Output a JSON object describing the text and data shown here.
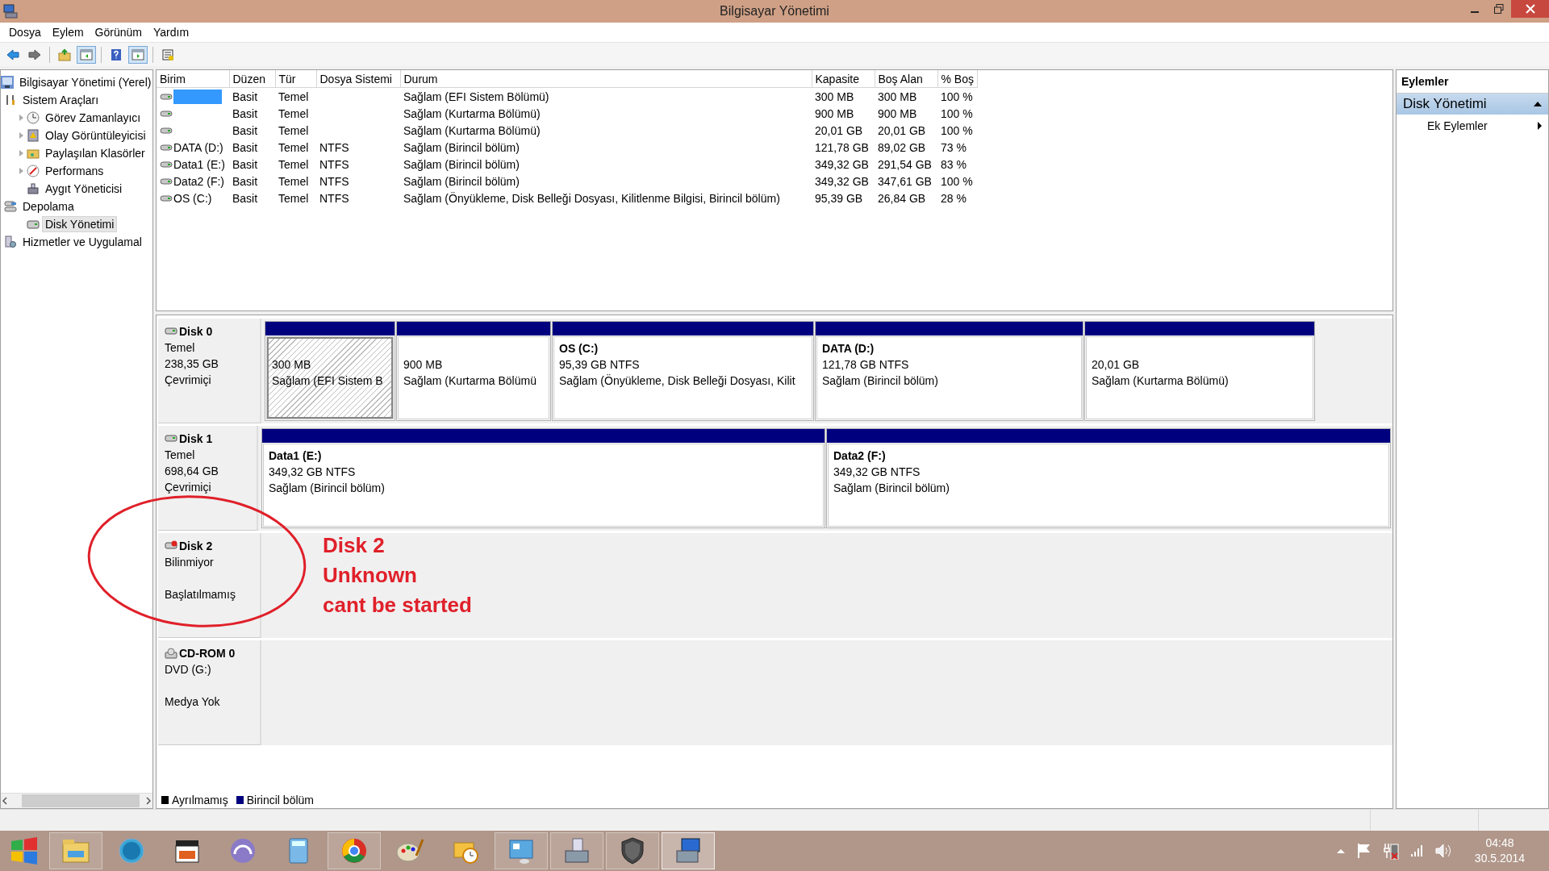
{
  "window": {
    "title": "Bilgisayar Yönetimi"
  },
  "menu": [
    "Dosya",
    "Eylem",
    "Görünüm",
    "Yardım"
  ],
  "toolbar": [
    {
      "pressed": false
    },
    {
      "pressed": false
    },
    {
      "pressed": false
    },
    {
      "pressed": true
    },
    {
      "pressed": false
    },
    {
      "pressed": true
    },
    {
      "pressed": false
    }
  ],
  "tree": [
    {
      "label": "Bilgisayar Yönetimi (Yerel)",
      "expandable": false,
      "selected": false,
      "children": [
        {
          "label": "Sistem Araçları",
          "expandable": false,
          "selected": false,
          "children": [
            {
              "label": "Görev Zamanlayıcı",
              "expandable": true,
              "selected": false
            },
            {
              "label": "Olay Görüntüleyicisi",
              "expandable": true,
              "selected": false
            },
            {
              "label": "Paylaşılan Klasörler",
              "expandable": true,
              "selected": false
            },
            {
              "label": "Performans",
              "expandable": true,
              "selected": false
            },
            {
              "label": "Aygıt Yöneticisi",
              "expandable": false,
              "selected": false
            }
          ]
        },
        {
          "label": "Depolama",
          "expandable": false,
          "selected": false,
          "children": [
            {
              "label": "Disk Yönetimi",
              "expandable": false,
              "selected": true
            }
          ]
        },
        {
          "label": "Hizmetler ve Uygulamal",
          "expandable": false,
          "selected": false
        }
      ]
    }
  ],
  "table": {
    "columns": [
      "Birim",
      "Düzen",
      "Tür",
      "Dosya Sistemi",
      "Durum",
      "Kapasite",
      "Boş Alan",
      "% Boş"
    ],
    "rows": [
      {
        "selected": true,
        "layout": "Basit",
        "type": "Temel",
        "status": "Sağlam (EFI Sistem Bölümü)",
        "capacity": "300 MB",
        "free": "300 MB",
        "free_pct": "100 %"
      },
      {
        "selected": false,
        "layout": "Basit",
        "type": "Temel",
        "status": "Sağlam (Kurtarma Bölümü)",
        "capacity": "900 MB",
        "free": "900 MB",
        "free_pct": "100 %"
      },
      {
        "selected": false,
        "layout": "Basit",
        "type": "Temel",
        "status": "Sağlam (Kurtarma Bölümü)",
        "capacity": "20,01 GB",
        "free": "20,01 GB",
        "free_pct": "100 %"
      },
      {
        "selected": false,
        "volume": "DATA (D:)",
        "layout": "Basit",
        "type": "Temel",
        "fs": "NTFS",
        "status": "Sağlam (Birincil bölüm)",
        "capacity": "121,78 GB",
        "free": "89,02 GB",
        "free_pct": "73 %"
      },
      {
        "selected": false,
        "volume": "Data1 (E:)",
        "layout": "Basit",
        "type": "Temel",
        "fs": "NTFS",
        "status": "Sağlam (Birincil bölüm)",
        "capacity": "349,32 GB",
        "free": "291,54 GB",
        "free_pct": "83 %"
      },
      {
        "selected": false,
        "volume": "Data2 (F:)",
        "layout": "Basit",
        "type": "Temel",
        "fs": "NTFS",
        "status": "Sağlam (Birincil bölüm)",
        "capacity": "349,32 GB",
        "free": "347,61 GB",
        "free_pct": "100 %"
      },
      {
        "selected": false,
        "volume": "OS (C:)",
        "layout": "Basit",
        "type": "Temel",
        "fs": "NTFS",
        "status": "Sağlam (Önyükleme, Disk Belleği Dosyası, Kilitlenme Bilgisi, Birincil bölüm)",
        "capacity": "95,39 GB",
        "free": "26,84 GB",
        "free_pct": "28 %"
      }
    ]
  },
  "disks": [
    {
      "name": "Disk 0",
      "kind": "disk",
      "type": "Temel",
      "size": "238,35 GB",
      "status": "Çevrimiçi",
      "partitions": [
        {
          "size": "300 MB",
          "status": "Sağlam (EFI Sistem B",
          "selected": true
        },
        {
          "size": "900 MB",
          "status": "Sağlam (Kurtarma Bölümü",
          "selected": false
        },
        {
          "title": "OS  (C:)",
          "size": "95,39 GB NTFS",
          "status": "Sağlam (Önyükleme, Disk Belleği Dosyası, Kilit",
          "selected": false
        },
        {
          "title": "DATA  (D:)",
          "size": "121,78 GB NTFS",
          "status": "Sağlam (Birincil bölüm)",
          "selected": false
        },
        {
          "size": "20,01 GB",
          "status": "Sağlam (Kurtarma Bölümü)",
          "selected": false
        }
      ]
    },
    {
      "name": "Disk 1",
      "kind": "disk",
      "type": "Temel",
      "size": "698,64 GB",
      "status": "Çevrimiçi",
      "partitions": [
        {
          "title": "Data1  (E:)",
          "size": "349,32 GB NTFS",
          "status": "Sağlam (Birincil bölüm)",
          "selected": false
        },
        {
          "title": "Data2  (F:)",
          "size": "349,32 GB NTFS",
          "status": "Sağlam (Birincil bölüm)",
          "selected": false
        }
      ]
    },
    {
      "name": "Disk 2",
      "kind": "unknown",
      "type": "Bilinmiyor",
      "status": "Başlatılmamış"
    },
    {
      "name": "CD-ROM 0",
      "kind": "cdrom",
      "type": "DVD (G:)",
      "status": "Medya Yok"
    }
  ],
  "legend": [
    {
      "label": "Ayrılmamış",
      "color": "#000000"
    },
    {
      "label": "Birincil bölüm",
      "color": "#00007f"
    }
  ],
  "actions": {
    "header": "Eylemler",
    "section": {
      "label": "Disk Yönetimi",
      "expanded": true
    },
    "items": [
      "Ek Eylemler"
    ]
  },
  "annotation": {
    "lines": [
      "Disk 2",
      "Unknown",
      "cant be started"
    ]
  },
  "taskbar": {
    "apps": [
      {
        "running": true,
        "selected": false
      },
      {
        "running": false,
        "selected": false
      },
      {
        "running": false,
        "selected": false
      },
      {
        "running": false,
        "selected": false
      },
      {
        "running": false,
        "selected": false
      },
      {
        "running": true,
        "selected": false
      },
      {
        "running": false,
        "selected": false
      },
      {
        "running": false,
        "selected": false
      },
      {
        "running": true,
        "selected": false
      },
      {
        "running": true,
        "selected": false
      },
      {
        "running": true,
        "selected": false
      },
      {
        "running": true,
        "selected": true
      }
    ],
    "time": "04:48",
    "date": "30.5.2014"
  }
}
